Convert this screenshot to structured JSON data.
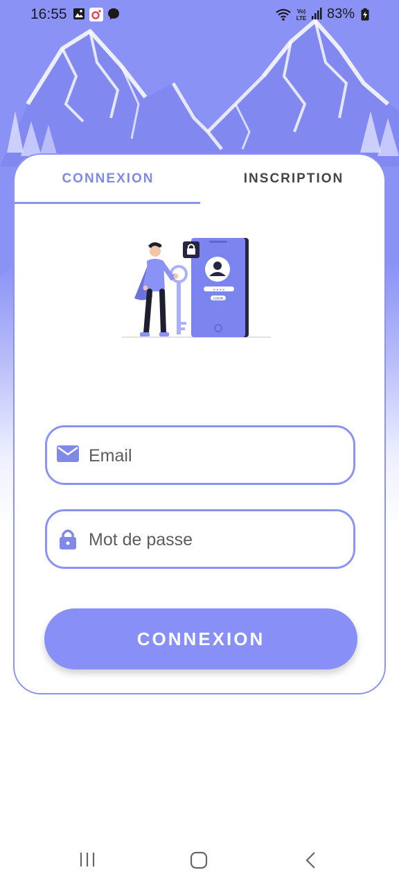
{
  "status_bar": {
    "time": "16:55",
    "battery": "83%",
    "icons": [
      "gallery-icon",
      "instagram-icon",
      "messenger-icon",
      "wifi-icon",
      "volte-icon",
      "signal-icon",
      "battery-charging-icon"
    ]
  },
  "tabs": [
    {
      "label": "CONNEXION",
      "active": true
    },
    {
      "label": "INSCRIPTION",
      "active": false
    }
  ],
  "illustration": {
    "button_label": "LOGIN"
  },
  "form": {
    "email_placeholder": "Email",
    "password_placeholder": "Mot de passe",
    "submit_label": "CONNEXION"
  },
  "nav": [
    "recents-icon",
    "home-icon",
    "back-icon"
  ],
  "colors": {
    "accent": "#8b92f6",
    "button": "#8890f7",
    "tab_active": "#8088e8",
    "tab_inactive": "#444444"
  }
}
